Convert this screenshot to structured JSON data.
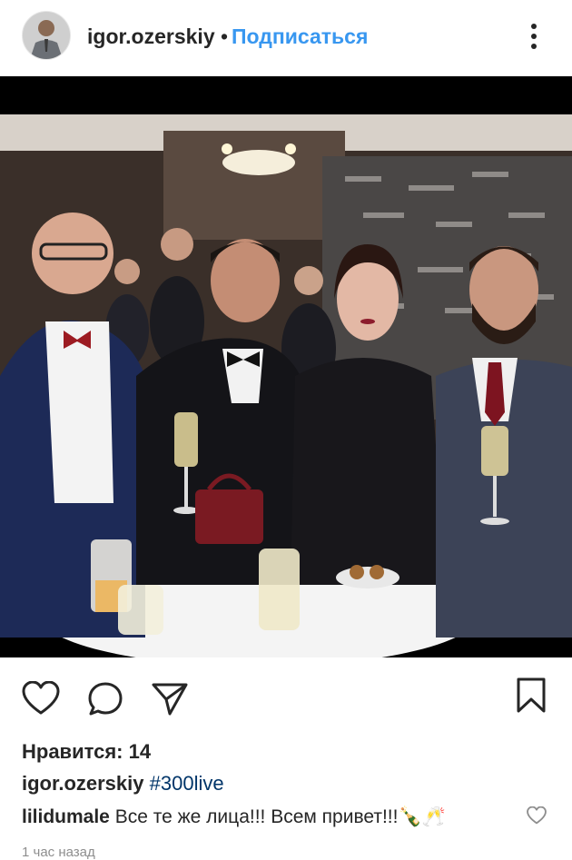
{
  "header": {
    "username": "igor.ozerskiy",
    "separator": "•",
    "follow_label": "Подписаться"
  },
  "post": {
    "image_alt": "photo",
    "likes_text": "Нравится: 14",
    "caption": {
      "username": "igor.ozerskiy",
      "hashtag": "#300live"
    },
    "comment": {
      "username": "lilidumale",
      "text": "Все те же лица!!! Всем привет!!!🍾🥂"
    },
    "time": "1 час назад"
  },
  "icons": {
    "like": "heart-icon",
    "comment": "comment-icon",
    "share": "share-icon",
    "save": "bookmark-icon",
    "more": "more-icon",
    "comment_like": "heart-icon"
  },
  "colors": {
    "link_blue": "#3897f0",
    "hashtag": "#003569",
    "muted": "#8e8e8e"
  }
}
